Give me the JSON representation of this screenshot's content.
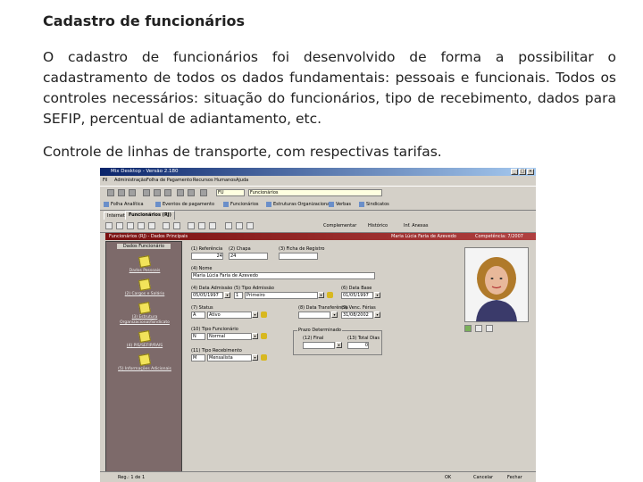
{
  "slide": {
    "title": "Cadastro de funcionários",
    "paragraph1": "O cadastro de funcionários foi desenvolvido de forma a possibilitar o cadastramento de todos os dados fundamentais: pessoais e funcionais. Todos os controles necessários: situação do funcionários, tipo de recebimento, dados para SEFIP, percentual de adiantamento, etc.",
    "paragraph2": "Controle de linhas de transporte, com respectivas tarifas."
  },
  "app": {
    "window_title": "Mix Desktop - Versão 2.180",
    "menu": [
      "Fil",
      "Administração",
      "Folha de Pagamento",
      "Recursos Humanos",
      "Ajuda"
    ],
    "top_fields": {
      "company_code": "FU",
      "module": "Funcionários"
    },
    "nav_items": [
      "Folha Analítica",
      "Eventos de pagamento",
      "Funcionários",
      "Estruturas Organizacionais",
      "Verbas",
      "Sindicatos"
    ],
    "tabs": [
      "Internet",
      "Funcionários (RJ)"
    ],
    "toolbar2_labels": [
      "Complementar",
      "Histórico",
      "Inf. Anexas"
    ],
    "inner_title": "Funcionários (RJ) - Dados Principais",
    "inner_name": "Maria Lúcia Faria de Azevedo",
    "inner_company": "Competência: 7/2007",
    "left_panel": {
      "header": "Dados Funcionário",
      "items": [
        "Dados Pessoais",
        "(2) Cargos e Salário",
        "(3) Estrutura Organizacional/Sindicato",
        "(4) PIS/SEFIP/RAIS",
        "(5) Informações Adicionais"
      ]
    },
    "form": {
      "labels": {
        "referencia": "(1) Referência",
        "chapa": "(2) Chapa",
        "ficha": "(3) Ficha de Registro",
        "nome": "(4) Nome",
        "data_admissao": "(4) Data Admissão",
        "tipo_admissao": "(5) Tipo Admissão",
        "data_base": "(6) Data Base",
        "status": "(7) Status",
        "data_transferencia": "(8) Data Transferência",
        "venc_ferias": "(9) Venc. Férias",
        "tipo_funcionario": "(10) Tipo Funcionário",
        "prazo_determinado": "Prazo Determinado",
        "final": "(12) Final",
        "total_dias": "(13) Total Dias",
        "tipo_recebimento": "(11) Tipo Recebimento"
      },
      "values": {
        "referencia": "24",
        "chapa": "24",
        "ficha": "",
        "nome": "Maria Lúcia Faria de Azevedo",
        "data_admissao": "05/05/1997",
        "tipo_admissao_code": "1",
        "tipo_admissao": "Primeiro",
        "data_base": "01/05/1997",
        "status_code": "A",
        "status": "Ativo",
        "data_transferencia": "",
        "venc_ferias": "31/08/2002",
        "tipo_funcionario_code": "N",
        "tipo_funcionario": "Normal",
        "final": "",
        "total_dias": "0",
        "tipo_recebimento_code": "M",
        "tipo_recebimento": "Mensalista"
      }
    },
    "statusbar": {
      "record": "Reg.: 1 de 1",
      "ok": "OK",
      "cancel": "Cancelar",
      "close": "Fechar"
    },
    "colors": {
      "titlebar": "#0a246a",
      "inner_bar": "#7a1010",
      "left_panel": "#7d6a6a",
      "icon_yellow": "#f2e35a"
    }
  }
}
